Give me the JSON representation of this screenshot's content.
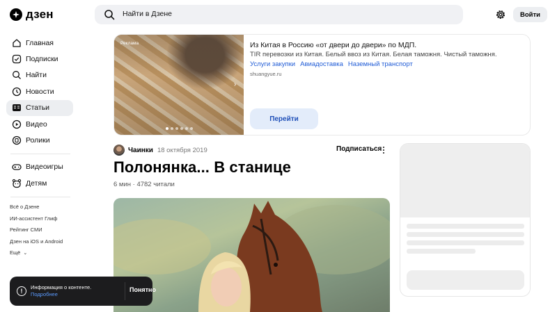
{
  "header": {
    "logo_text": "дзен",
    "search_placeholder": "Найти в Дзене",
    "login_label": "Войти"
  },
  "sidebar": {
    "items": [
      {
        "label": "Главная",
        "icon": "home-icon"
      },
      {
        "label": "Подписки",
        "icon": "subscriptions-icon"
      },
      {
        "label": "Найти",
        "icon": "search-icon"
      },
      {
        "label": "Новости",
        "icon": "news-icon"
      },
      {
        "label": "Статьи",
        "icon": "articles-icon",
        "active": true
      },
      {
        "label": "Видео",
        "icon": "video-icon"
      },
      {
        "label": "Ролики",
        "icon": "shorts-icon"
      }
    ],
    "items2": [
      {
        "label": "Видеоигры",
        "icon": "gamepad-icon"
      },
      {
        "label": "Детям",
        "icon": "kids-icon"
      }
    ],
    "footer_links": [
      "Всё о Дзене",
      "ИИ-ассистент Глиф",
      "Рейтинг СМИ",
      "Дзен на iOS и Android",
      "Ещё"
    ]
  },
  "ad": {
    "label": "Реклама",
    "title": "Из Китая в Россию «от двери до двери» по МДП.",
    "description": "TIR перевозки из Китая. Белый ввоз из Китая. Белая таможня. Чистый таможня.",
    "links": [
      "Услуги закупки",
      "Авиадоставка",
      "Наземный транспорт"
    ],
    "domain": "shuangyue.ru",
    "button_label": "Перейти"
  },
  "article": {
    "author": "Чаинки",
    "date": "18 октября 2019",
    "subscribe_label": "Подписаться",
    "title": "Полонянка... В станице",
    "meta": "6 мин · 4782 читали"
  },
  "notice": {
    "text": "Информация о контенте.",
    "link": "Подробнее",
    "button": "Понятно"
  },
  "colors": {
    "accent": "#1f5bd6",
    "active_bg": "#eceef1",
    "notice_bg": "#1c1c1e"
  }
}
